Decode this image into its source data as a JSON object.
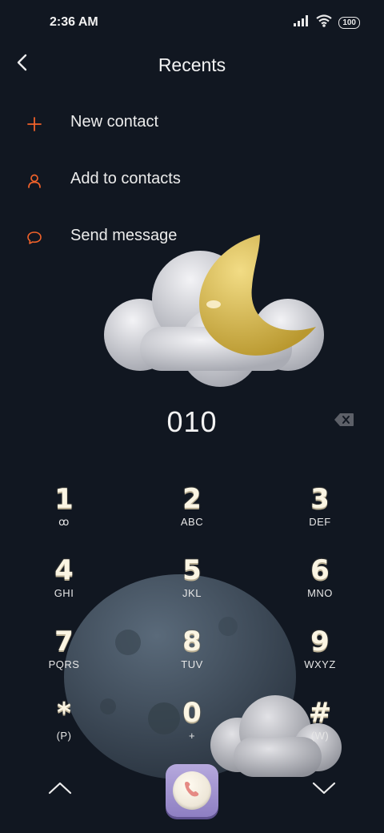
{
  "status_bar": {
    "time": "2:36 AM",
    "battery": "100",
    "icons": [
      "signal-icon",
      "wifi-icon",
      "battery-icon"
    ]
  },
  "header": {
    "title": "Recents",
    "back_icon": "back-arrow-icon"
  },
  "actions": [
    {
      "label": "New contact",
      "icon": "plus-icon"
    },
    {
      "label": "Add to contacts",
      "icon": "person-icon"
    },
    {
      "label": "Send message",
      "icon": "message-bubble-icon"
    }
  ],
  "dialer": {
    "number": "010",
    "backspace_icon": "backspace-icon"
  },
  "keypad": [
    {
      "digit": "1",
      "letters": "ꝏ"
    },
    {
      "digit": "2",
      "letters": "ABC"
    },
    {
      "digit": "3",
      "letters": "DEF"
    },
    {
      "digit": "4",
      "letters": "GHI"
    },
    {
      "digit": "5",
      "letters": "JKL"
    },
    {
      "digit": "6",
      "letters": "MNO"
    },
    {
      "digit": "7",
      "letters": "PQRS"
    },
    {
      "digit": "8",
      "letters": "TUV"
    },
    {
      "digit": "9",
      "letters": "WXYZ"
    },
    {
      "digit": "*",
      "letters": "(P)"
    },
    {
      "digit": "0",
      "letters": "+"
    },
    {
      "digit": "#",
      "letters": "(W)"
    }
  ],
  "bottom_bar": {
    "up_icon": "chevron-up-icon",
    "call_icon": "phone-icon",
    "down_icon": "chevron-down-icon"
  },
  "colors": {
    "background": "#111721",
    "accent": "#f0622a",
    "call_button": "#a597d4"
  }
}
